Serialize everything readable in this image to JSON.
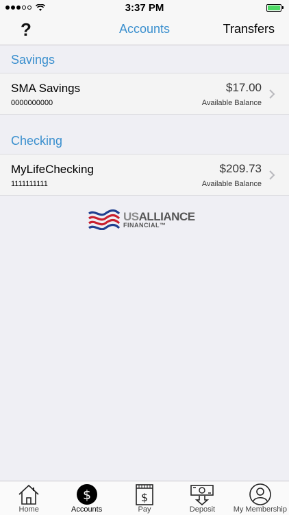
{
  "status_bar": {
    "time": "3:37 PM"
  },
  "nav": {
    "help_label": "?",
    "title": "Accounts",
    "transfers_label": "Transfers"
  },
  "colors": {
    "accent": "#3a8fce",
    "background": "#efeff4",
    "battery": "#4cd964"
  },
  "sections": [
    {
      "title": "Savings",
      "accounts": [
        {
          "name": "SMA Savings",
          "number": "0000000000",
          "balance": "$17.00",
          "balance_label": "Available Balance"
        }
      ]
    },
    {
      "title": "Checking",
      "accounts": [
        {
          "name": "MyLifeChecking",
          "number": "1111111111",
          "balance": "$209.73",
          "balance_label": "Available Balance"
        }
      ]
    }
  ],
  "logo": {
    "line1_us": "US",
    "line1_rest": "ALLIANCE",
    "line2": "FINANCIAL™"
  },
  "tab_bar": {
    "active": "Accounts",
    "items": [
      {
        "label": "Home",
        "icon": "house-icon"
      },
      {
        "label": "Accounts",
        "icon": "dollar-circle-icon"
      },
      {
        "label": "Pay",
        "icon": "bill-icon"
      },
      {
        "label": "Deposit",
        "icon": "deposit-icon"
      },
      {
        "label": "My Membership",
        "icon": "user-icon"
      }
    ]
  }
}
